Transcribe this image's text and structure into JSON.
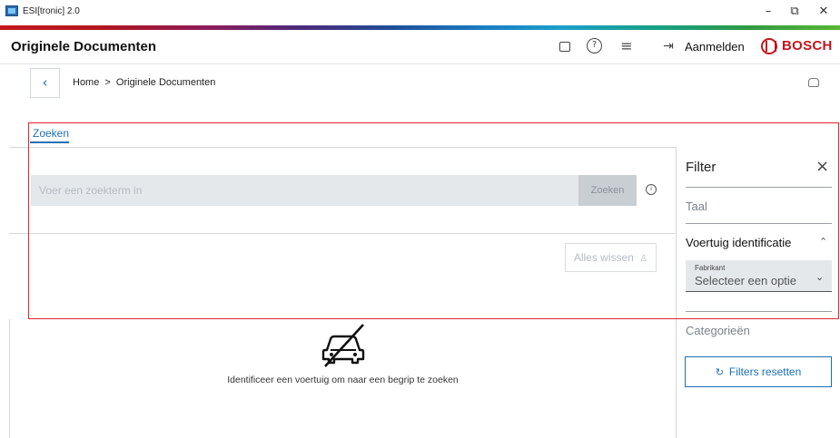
{
  "window": {
    "title": "ESI[tronic] 2.0",
    "minimize_glyph": "–",
    "restore_glyph": "⧉",
    "close_glyph": "✕"
  },
  "header": {
    "page_title": "Originele Documenten",
    "login_label": "Aanmelden",
    "brand": "BOSCH",
    "icons": [
      "screen-icon",
      "help-icon",
      "menu-icon",
      "login-icon",
      "bosch-logo"
    ]
  },
  "breadcrumb": {
    "home": "Home",
    "separator": ">",
    "current": "Originele Documenten"
  },
  "tabs": [
    {
      "label": "Zoeken",
      "active": true
    }
  ],
  "search": {
    "placeholder": "Voer een zoekterm in",
    "button_label": "Zoeken",
    "clear_label": "Alles wissen"
  },
  "empty_state": {
    "message": "Identificeer een voertuig om naar een begrip te zoeken"
  },
  "filter": {
    "title": "Filter",
    "language_label": "Taal",
    "vehicle_id_label": "Voertuig identificatie",
    "manufacturer_label": "Fabrikant",
    "manufacturer_value": "Selecteer een optie",
    "categories_label": "Categorieën",
    "reset_label": "Filters resetten"
  },
  "colors": {
    "accent": "#1b6fb5",
    "brand_red": "#c4161c",
    "highlight": "#e0262b"
  }
}
